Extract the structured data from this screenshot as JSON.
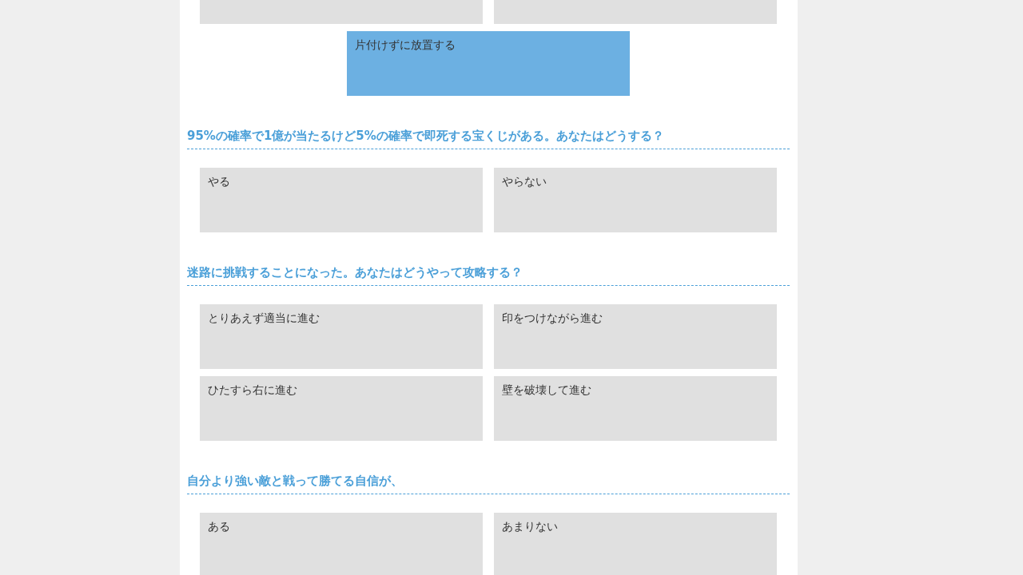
{
  "questions": [
    {
      "options": [
        {
          "selected": false
        },
        {
          "selected": false
        },
        {
          "text": "片付けずに放置する",
          "selected": true
        }
      ]
    },
    {
      "title": "95%の確率で1億が当たるけど5%の確率で即死する宝くじがある。あなたはどうする？",
      "options": [
        {
          "text": "やる",
          "selected": false
        },
        {
          "text": "やらない",
          "selected": false
        }
      ]
    },
    {
      "title": "迷路に挑戦することになった。あなたはどうやって攻略する？",
      "options": [
        {
          "text": "とりあえず適当に進む",
          "selected": false
        },
        {
          "text": "印をつけながら進む",
          "selected": false
        },
        {
          "text": "ひたすら右に進む",
          "selected": false
        },
        {
          "text": "壁を破壊して進む",
          "selected": false
        }
      ]
    },
    {
      "title": "自分より強い敵と戦って勝てる自信が、",
      "options": [
        {
          "text": "ある",
          "selected": false
        },
        {
          "text": "あまりない",
          "selected": false
        }
      ]
    }
  ]
}
